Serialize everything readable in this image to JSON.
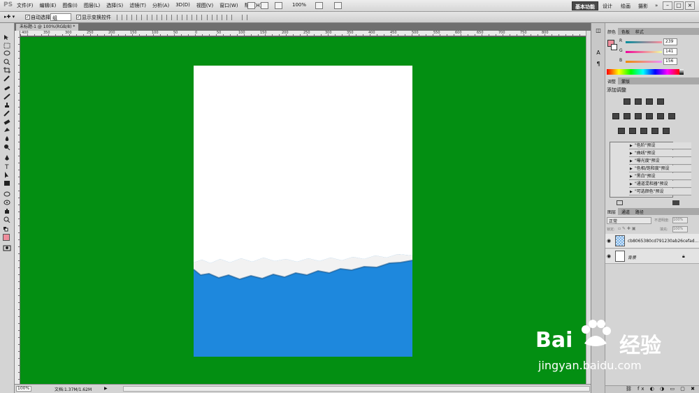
{
  "app": {
    "logo": "PS"
  },
  "menu": {
    "items": [
      "文件(F)",
      "编辑(E)",
      "图像(I)",
      "图层(L)",
      "选择(S)",
      "滤镜(T)",
      "分析(A)",
      "3D(D)",
      "视图(V)",
      "窗口(W)",
      "帮助(H)"
    ]
  },
  "menubar": {
    "zoom": "100%"
  },
  "workspaces": {
    "active": "基本功能",
    "design": "设计",
    "painting": "绘画",
    "photography": "摄影",
    "more": "»"
  },
  "options": {
    "auto_select_label": "自动选择:",
    "auto_select_value": "组",
    "show_transform_label": "显示变换控件"
  },
  "document": {
    "tab_title": "未标题-1 @ 100%(RGB/8) *"
  },
  "ruler": {
    "ticks": [
      "400",
      "350",
      "300",
      "250",
      "200",
      "150",
      "100",
      "50",
      "0",
      "50",
      "100",
      "150",
      "200",
      "250",
      "300",
      "350",
      "400",
      "450",
      "500",
      "550",
      "600",
      "650",
      "700",
      "750",
      "800"
    ]
  },
  "status": {
    "zoom": "100%",
    "doc_info": "文档:1.37M/1.62M"
  },
  "color_panel": {
    "tabs": [
      "颜色",
      "色板",
      "样式"
    ],
    "r_label": "R",
    "g_label": "G",
    "b_label": "B",
    "r": "239",
    "g": "141",
    "b": "156",
    "foreground": "#ef8d9c"
  },
  "adjust_panel": {
    "tabs": [
      "调整",
      "蒙版"
    ],
    "title": "添加调整",
    "presets": [
      "\"色阶\"预设",
      "\"曲线\"预设",
      "\"曝光度\"预设",
      "\"色相/饱和度\"预设",
      "\"黑白\"预设",
      "\"通道混和器\"预设",
      "\"可选颜色\"预设"
    ]
  },
  "layers_panel": {
    "tabs": [
      "图层",
      "通道",
      "路径"
    ],
    "blend_mode": "正常",
    "opacity_label": "不透明度:",
    "opacity": "100%",
    "lock_label": "锁定:",
    "fill_label": "填充:",
    "fill": "100%",
    "layers": [
      {
        "name": "cb8065380cd791230ab26cefad..."
      },
      {
        "name": "背景"
      }
    ]
  },
  "canvas": {
    "workspace_color": "#038f12",
    "paper_color": "#ffffff",
    "water_color": "#1e88dd"
  },
  "watermark": {
    "brand_left": "Bai",
    "brand_right": "经验",
    "url": "jingyan.baidu.com"
  }
}
